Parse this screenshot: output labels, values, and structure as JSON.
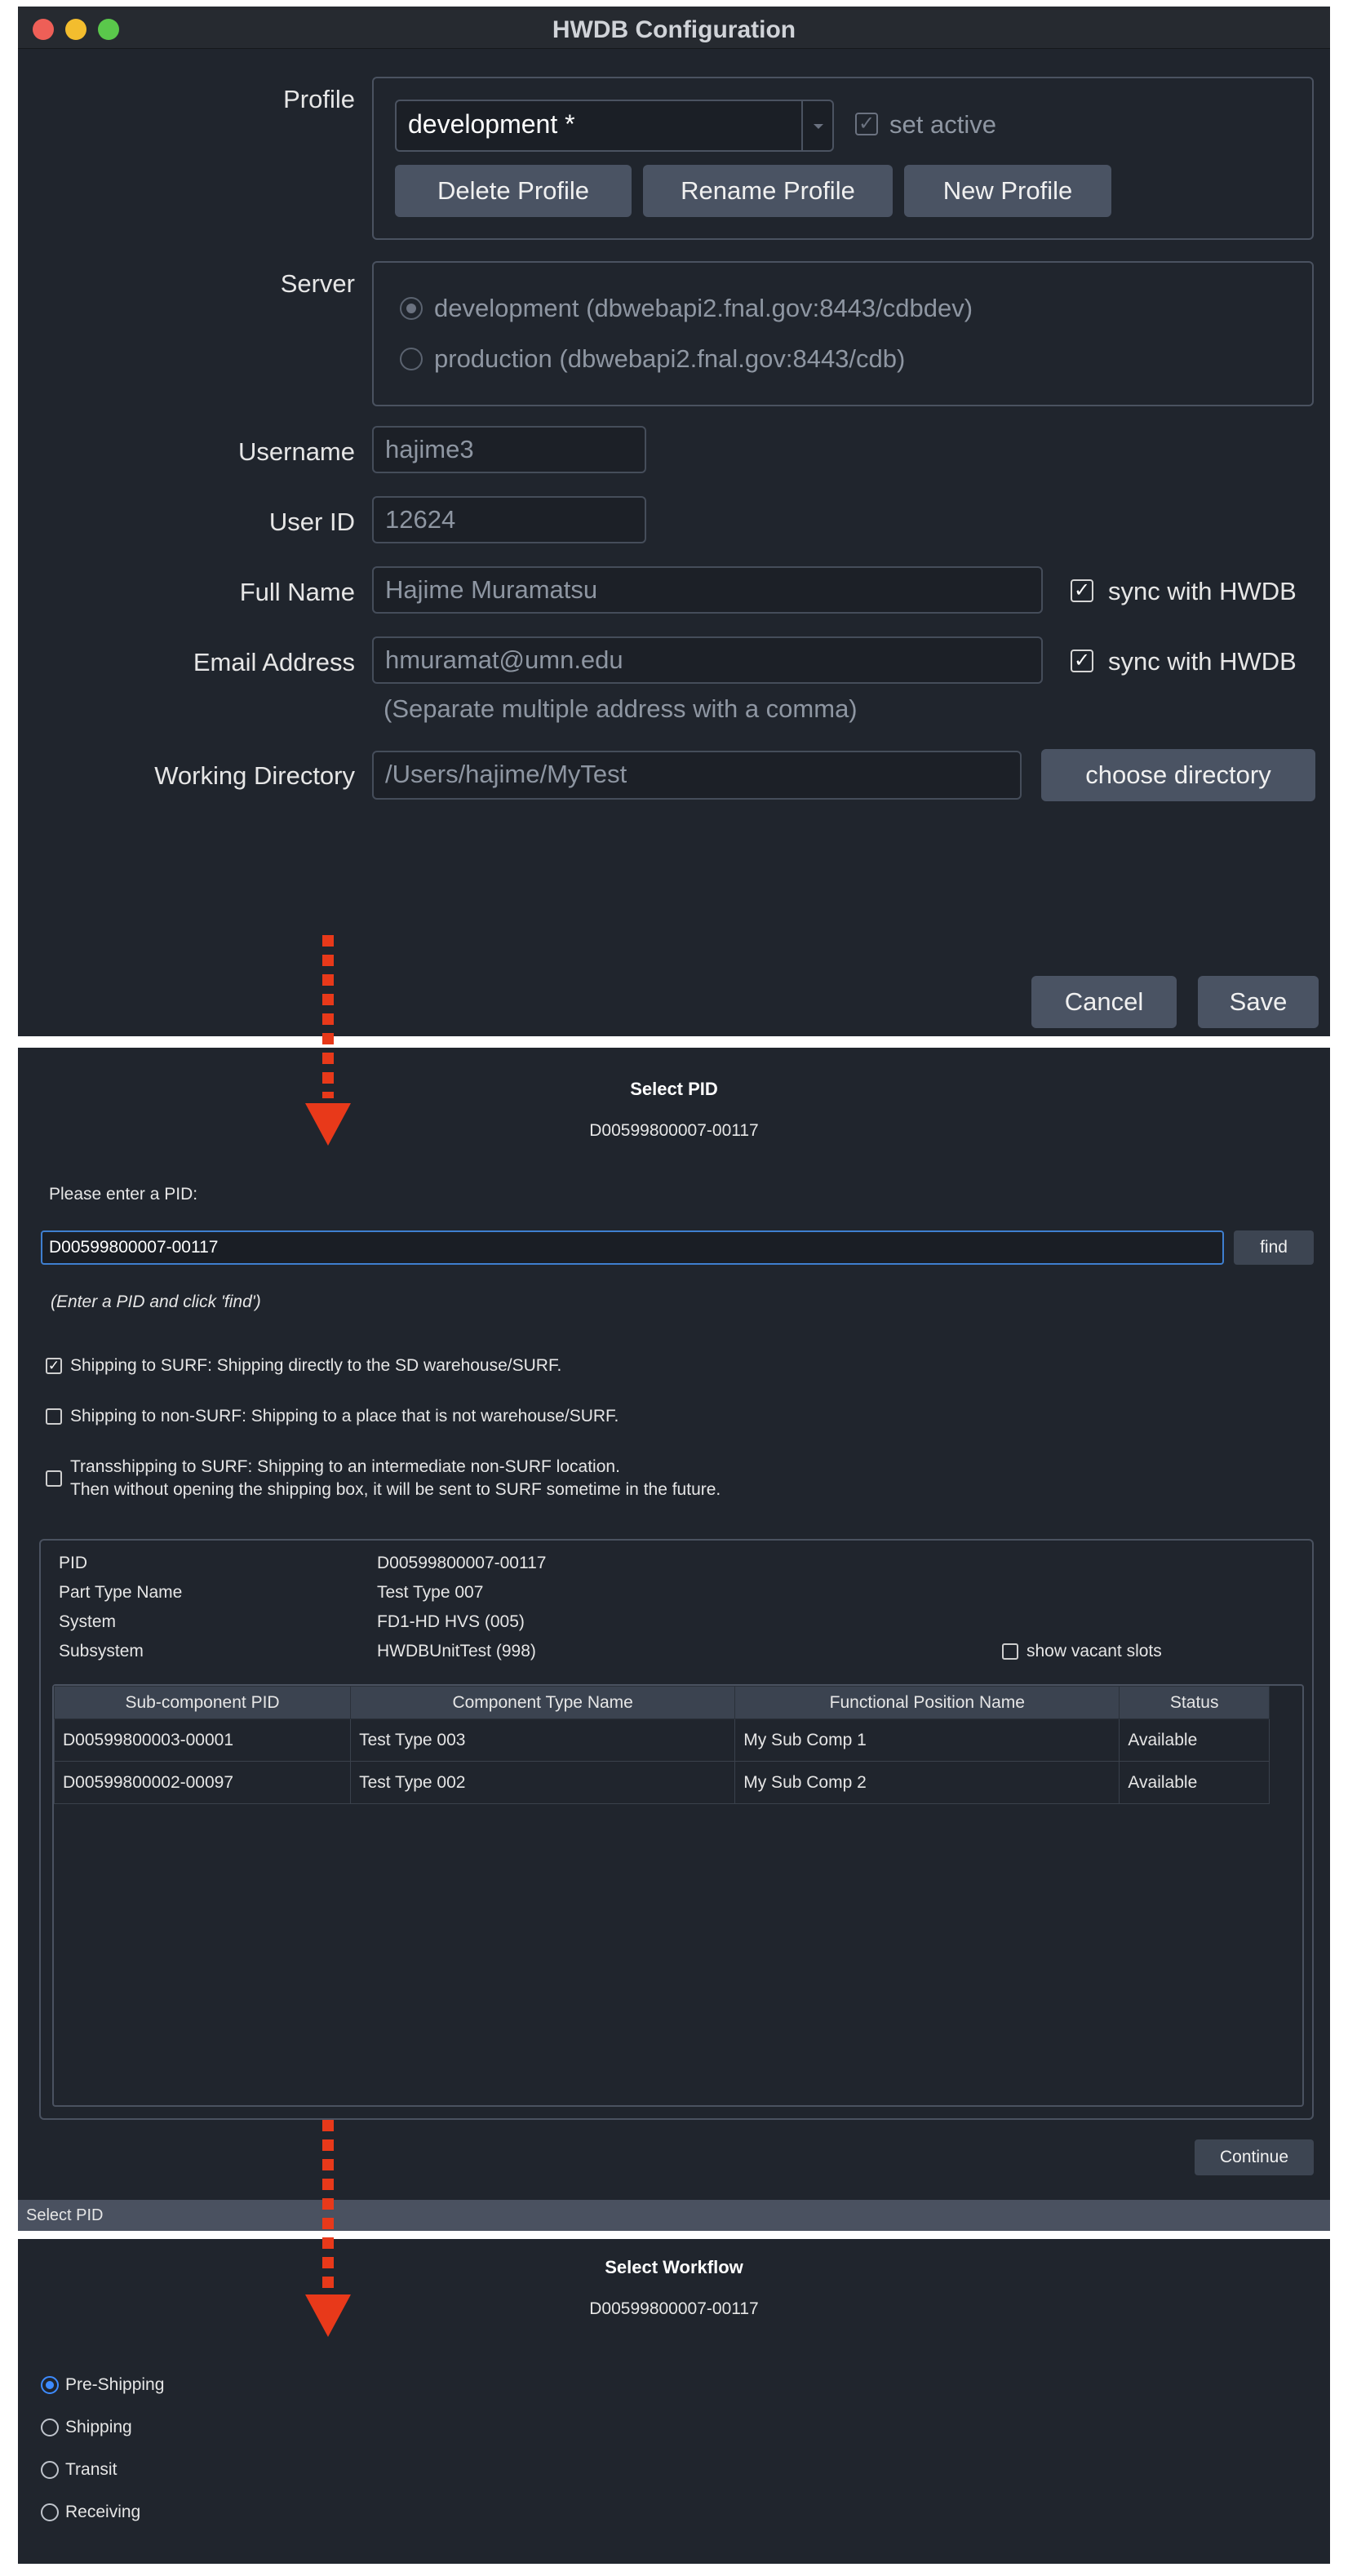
{
  "config": {
    "window_title": "HWDB Configuration",
    "traffic_colors": {
      "close": "#ee5f57",
      "minimize": "#f3bd2e",
      "maximize": "#5ac84b"
    },
    "labels": {
      "profile": "Profile",
      "server": "Server",
      "username": "Username",
      "user_id": "User ID",
      "full_name": "Full Name",
      "email": "Email Address",
      "working_dir": "Working Directory"
    },
    "profile": {
      "selected": "development *",
      "set_active_label": "set active",
      "set_active_checked": true,
      "buttons": {
        "delete": "Delete Profile",
        "rename": "Rename Profile",
        "new": "New Profile"
      }
    },
    "server": {
      "options": [
        {
          "label": "development (dbwebapi2.fnal.gov:8443/cdbdev)",
          "selected": true
        },
        {
          "label": "production (dbwebapi2.fnal.gov:8443/cdb)",
          "selected": false
        }
      ]
    },
    "username": "hajime3",
    "user_id": "12624",
    "full_name": "Hajime Muramatsu",
    "email": "hmuramat@umn.edu",
    "email_hint": "(Separate multiple address with a comma)",
    "sync_label": "sync with HWDB",
    "working_dir": "/Users/hajime/MyTest",
    "choose_dir_button": "choose directory",
    "cancel_button": "Cancel",
    "save_button": "Save"
  },
  "select_pid": {
    "title": "Select PID",
    "subtitle": "D00599800007-00117",
    "prompt": "Please enter a PID:",
    "input_value": "D00599800007-00117",
    "find_button": "find",
    "hint": "(Enter a PID and click 'find')",
    "shipping_options": [
      {
        "label": "Shipping to SURF: Shipping directly to the SD warehouse/SURF.",
        "checked": true
      },
      {
        "label": "Shipping to non-SURF: Shipping to a place that is not warehouse/SURF.",
        "checked": false
      },
      {
        "label": "Transshipping to SURF: Shipping to an intermediate non-SURF location.",
        "label2": "Then without opening the shipping box, it will be sent to SURF sometime in the future.",
        "checked": false
      }
    ],
    "info": {
      "pid_label": "PID",
      "pid_value": "D00599800007-00117",
      "part_type_label": "Part Type Name",
      "part_type_value": "Test Type 007",
      "system_label": "System",
      "system_value": "FD1-HD HVS (005)",
      "subsystem_label": "Subsystem",
      "subsystem_value": "HWDBUnitTest (998)"
    },
    "show_vacant_label": "show vacant slots",
    "table": {
      "headers": [
        "Sub-component PID",
        "Component Type Name",
        "Functional Position Name",
        "Status"
      ],
      "rows": [
        [
          "D00599800003-00001",
          "Test Type 003",
          "My Sub Comp 1",
          "Available"
        ],
        [
          "D00599800002-00097",
          "Test Type 002",
          "My Sub Comp 2",
          "Available"
        ]
      ]
    },
    "continue_button": "Continue",
    "status_bar": "Select PID"
  },
  "select_workflow": {
    "title": "Select Workflow",
    "subtitle": "D00599800007-00117",
    "options": [
      {
        "label": "Pre-Shipping",
        "selected": true
      },
      {
        "label": "Shipping",
        "selected": false
      },
      {
        "label": "Transit",
        "selected": false
      },
      {
        "label": "Receiving",
        "selected": false
      }
    ]
  },
  "accent_colors": {
    "arrow": "#e8391a",
    "focus": "#3f7fd0"
  }
}
